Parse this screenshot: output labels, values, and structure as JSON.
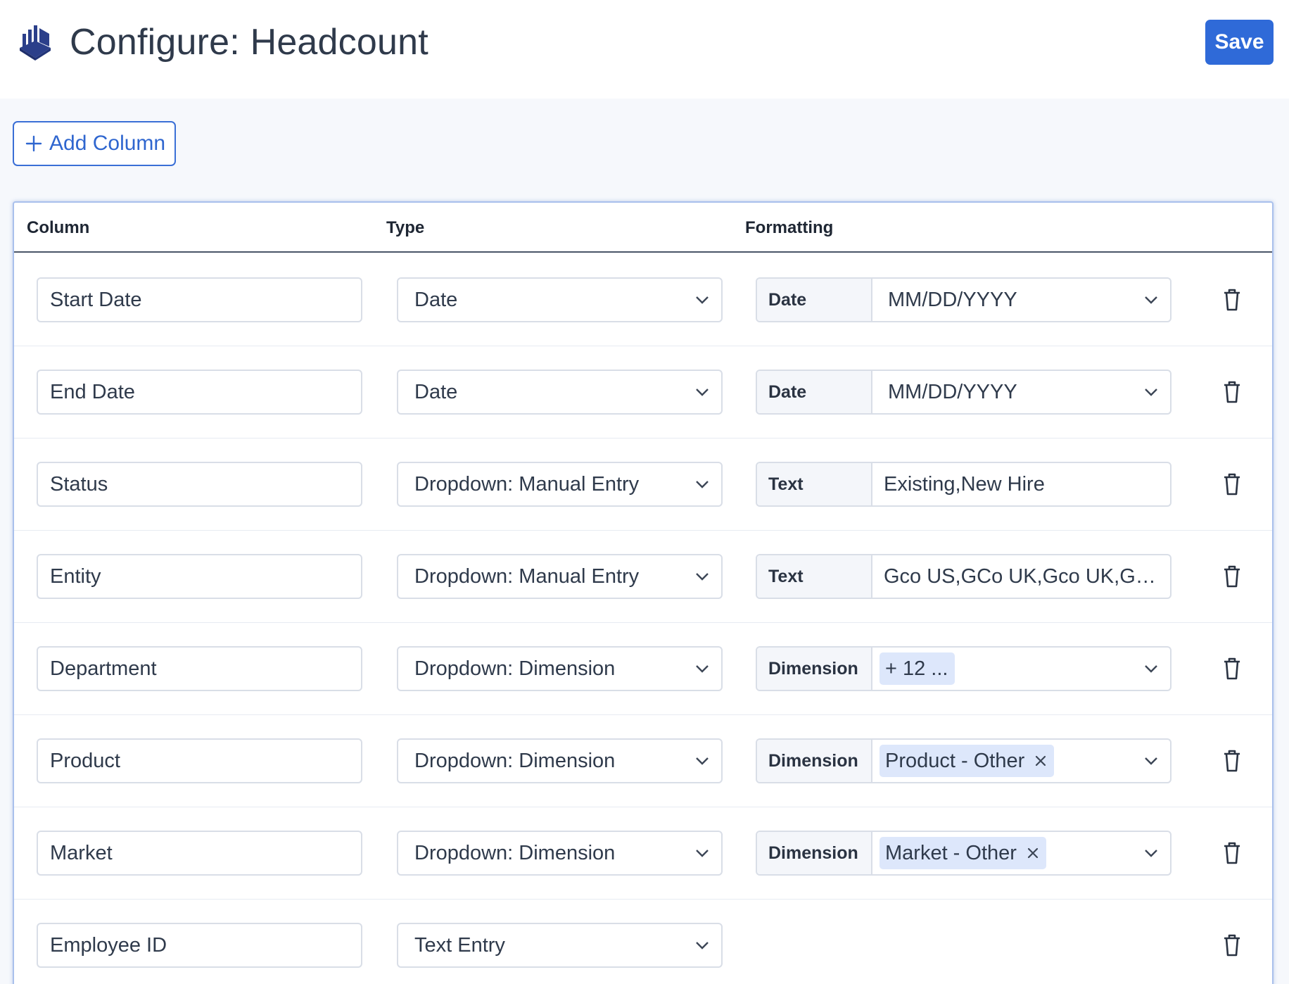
{
  "header": {
    "title": "Configure: Headcount",
    "save_label": "Save"
  },
  "toolbar": {
    "add_column_label": "Add Column"
  },
  "table": {
    "headers": {
      "column": "Column",
      "type": "Type",
      "formatting": "Formatting"
    },
    "rows": [
      {
        "column": "Start Date",
        "type": "Date",
        "format_kind": "Date",
        "format_value": "MM/DD/YYYY"
      },
      {
        "column": "End Date",
        "type": "Date",
        "format_kind": "Date",
        "format_value": "MM/DD/YYYY"
      },
      {
        "column": "Status",
        "type": "Dropdown: Manual Entry",
        "format_kind": "Text",
        "format_value": "Existing,New Hire"
      },
      {
        "column": "Entity",
        "type": "Dropdown: Manual Entry",
        "format_kind": "Text",
        "format_value": "Gco US,GCo UK,Gco UK,Gco US"
      },
      {
        "column": "Department",
        "type": "Dropdown: Dimension",
        "format_kind": "Dimension",
        "format_value": "+ 12 ..."
      },
      {
        "column": "Product",
        "type": "Dropdown: Dimension",
        "format_kind": "Dimension",
        "format_value": "Product - Other"
      },
      {
        "column": "Market",
        "type": "Dropdown: Dimension",
        "format_kind": "Dimension",
        "format_value": "Market - Other"
      },
      {
        "column": "Employee ID",
        "type": "Text Entry"
      }
    ]
  },
  "icons": {
    "logo": "cube-stack-logo-icon",
    "add": "plus-icon",
    "dropdown": "chevron-down-icon",
    "remove_tag": "close-icon",
    "delete": "trash-icon"
  },
  "colors": {
    "accent": "#2f6ad8",
    "logo": "#2b3f8a",
    "tag_bg": "#dde7fb",
    "page_bg": "#f6f8fc"
  }
}
